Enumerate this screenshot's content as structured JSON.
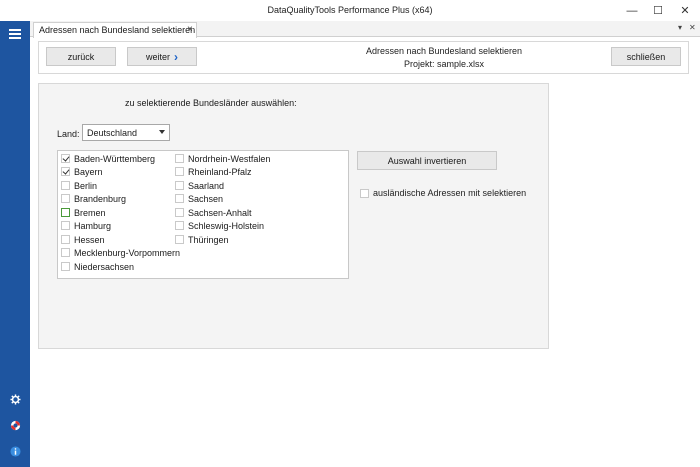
{
  "window": {
    "title": "DataQualityTools Performance Plus (x64)",
    "minimize_glyph": "—",
    "maximize_glyph": "☐",
    "close_glyph": "✕"
  },
  "sidebar": {
    "icons": [
      "menu-icon",
      "gear-icon",
      "lifebuoy-icon",
      "info-icon"
    ]
  },
  "tabs": [
    {
      "label": "Adressen nach Bundesland selektieren",
      "close": "×"
    }
  ],
  "tabstrip": {
    "dropdown_glyph": "▾",
    "close_glyph": "✕"
  },
  "header": {
    "back_label": "zurück",
    "next_label": "weiter",
    "next_glyph": "›",
    "title": "Adressen nach Bundesland selektieren",
    "project": "Projekt: sample.xlsx",
    "close_label": "schließen"
  },
  "form": {
    "instruction": "zu selektierende Bundesländer auswählen:",
    "land_label": "Land:",
    "land_value": "Deutschland",
    "invert_label": "Auswahl invertieren",
    "foreign_label": "ausländische Adressen mit selektieren",
    "foreign_checked": false,
    "states_col1": [
      {
        "name": "Baden-Württemberg",
        "checked": true
      },
      {
        "name": "Bayern",
        "checked": true
      },
      {
        "name": "Berlin",
        "checked": false
      },
      {
        "name": "Brandenburg",
        "checked": false
      },
      {
        "name": "Bremen",
        "checked": false
      },
      {
        "name": "Hamburg",
        "checked": false
      },
      {
        "name": "Hessen",
        "checked": false
      },
      {
        "name": "Mecklenburg-Vorpommern",
        "checked": false
      },
      {
        "name": "Niedersachsen",
        "checked": false
      }
    ],
    "states_col2": [
      {
        "name": "Nordrhein-Westfalen",
        "checked": false
      },
      {
        "name": "Rheinland-Pfalz",
        "checked": false
      },
      {
        "name": "Saarland",
        "checked": false
      },
      {
        "name": "Sachsen",
        "checked": false
      },
      {
        "name": "Sachsen-Anhalt",
        "checked": false
      },
      {
        "name": "Schleswig-Holstein",
        "checked": false
      },
      {
        "name": "Thüringen",
        "checked": false
      }
    ]
  },
  "colors": {
    "sidebar": "#1e55a0",
    "panel": "#f4f4f4",
    "button": "#e9e9e9",
    "accent_arrow": "#1e64c8"
  }
}
